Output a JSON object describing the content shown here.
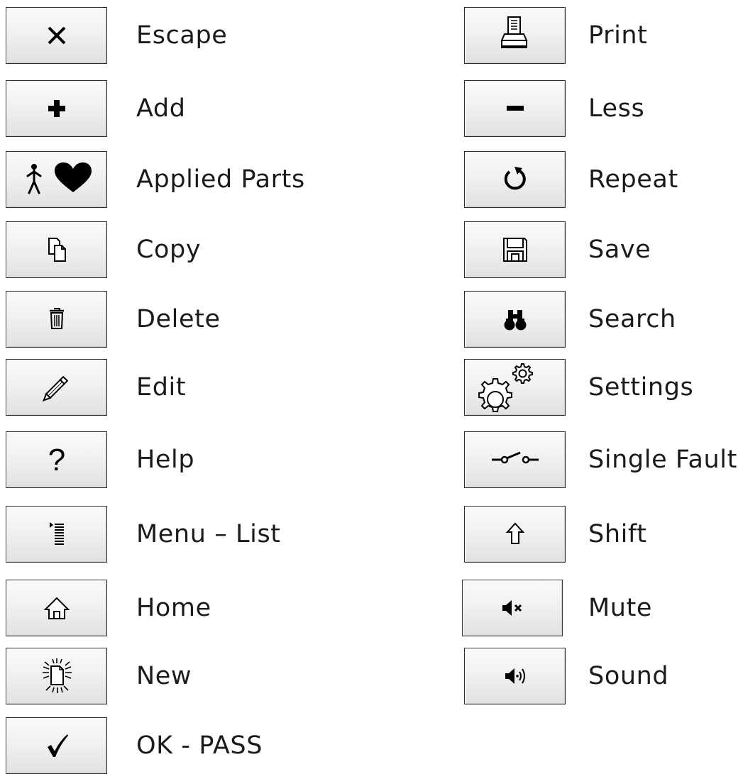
{
  "left_items": [
    {
      "label": "Escape",
      "icon": "close-icon"
    },
    {
      "label": "Add",
      "icon": "plus-icon"
    },
    {
      "label": "Applied Parts",
      "icon": "person-heart-icon"
    },
    {
      "label": "Copy",
      "icon": "copy-icon"
    },
    {
      "label": "Delete",
      "icon": "trash-icon"
    },
    {
      "label": "Edit",
      "icon": "pencil-icon"
    },
    {
      "label": "Help",
      "icon": "question-icon"
    },
    {
      "label": "Menu – List",
      "icon": "menu-list-icon"
    },
    {
      "label": "Home",
      "icon": "home-icon"
    },
    {
      "label": "New",
      "icon": "new-document-icon"
    },
    {
      "label": "OK - PASS",
      "icon": "checkmark-icon"
    }
  ],
  "right_items": [
    {
      "label": "Print",
      "icon": "printer-icon"
    },
    {
      "label": "Less",
      "icon": "minus-icon"
    },
    {
      "label": "Repeat",
      "icon": "repeat-icon"
    },
    {
      "label": "Save",
      "icon": "floppy-disk-icon"
    },
    {
      "label": "Search",
      "icon": "binoculars-icon"
    },
    {
      "label": "Settings",
      "icon": "gears-icon"
    },
    {
      "label": "Single Fault",
      "icon": "switch-icon"
    },
    {
      "label": "Shift",
      "icon": "shift-arrow-icon"
    },
    {
      "label": "Mute",
      "icon": "speaker-mute-icon"
    },
    {
      "label": "Sound",
      "icon": "speaker-sound-icon"
    }
  ]
}
